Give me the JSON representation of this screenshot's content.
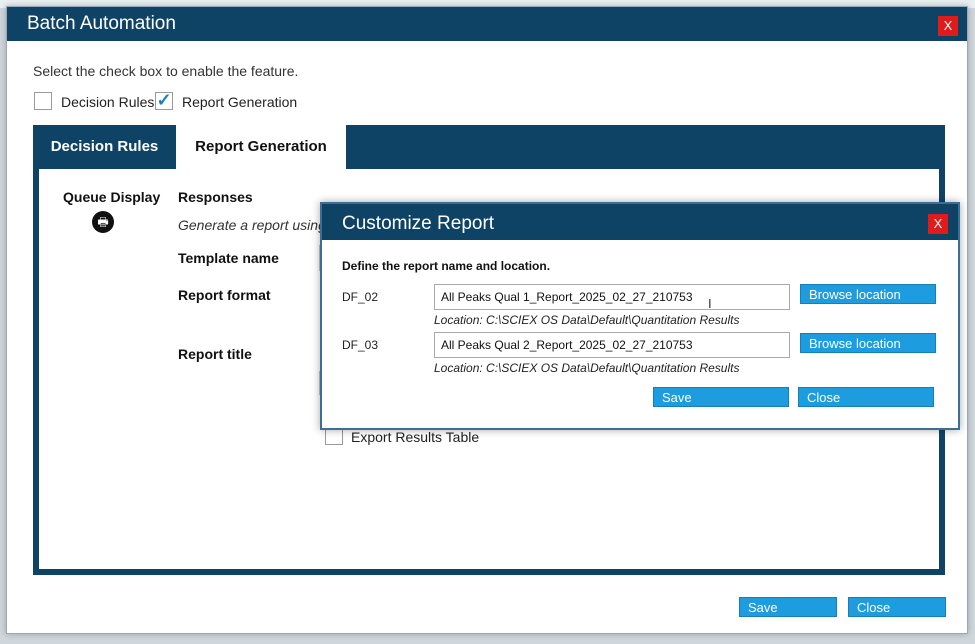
{
  "window": {
    "title": "Batch Automation",
    "close_glyph": "X"
  },
  "instruction": "Select the check box to enable the feature.",
  "features": {
    "decision_rules": {
      "label": "Decision Rules",
      "checked": false
    },
    "report_generation": {
      "label": "Report Generation",
      "checked": true,
      "check_glyph": "✓"
    }
  },
  "tabs": [
    {
      "label": "Decision Rules",
      "active": false
    },
    {
      "label": "Report Generation",
      "active": true
    }
  ],
  "panel": {
    "queue_display_label": "Queue Display",
    "queue_icon": "printer-icon",
    "queue_icon_glyph": "🖶",
    "responses_label": "Responses",
    "generate_text": "Generate a report using",
    "template_name_label": "Template name",
    "report_format_label": "Report format",
    "report_title_label": "Report title",
    "export_results_label": "Export Results Table",
    "export_results_checked": false
  },
  "dialog": {
    "title": "Customize Report",
    "close_glyph": "X",
    "heading": "Define the report name and location.",
    "rows": [
      {
        "label": "DF_02",
        "value": "All Peaks Qual 1_Report_2025_02_27_210753",
        "location": "Location: C:\\SCIEX OS Data\\Default\\Quantitation Results",
        "browse_label": "Browse location"
      },
      {
        "label": "DF_03",
        "value": "All Peaks Qual 2_Report_2025_02_27_210753",
        "location": "Location: C:\\SCIEX OS Data\\Default\\Quantitation Results",
        "browse_label": "Browse location"
      }
    ],
    "save_label": "Save",
    "close_label": "Close"
  },
  "footer": {
    "save_label": "Save",
    "close_label": "Close"
  },
  "colors": {
    "titlebar": "#0f4365",
    "button": "#1e9ce0",
    "close": "#e01b1b",
    "check": "#1b7fc4"
  }
}
